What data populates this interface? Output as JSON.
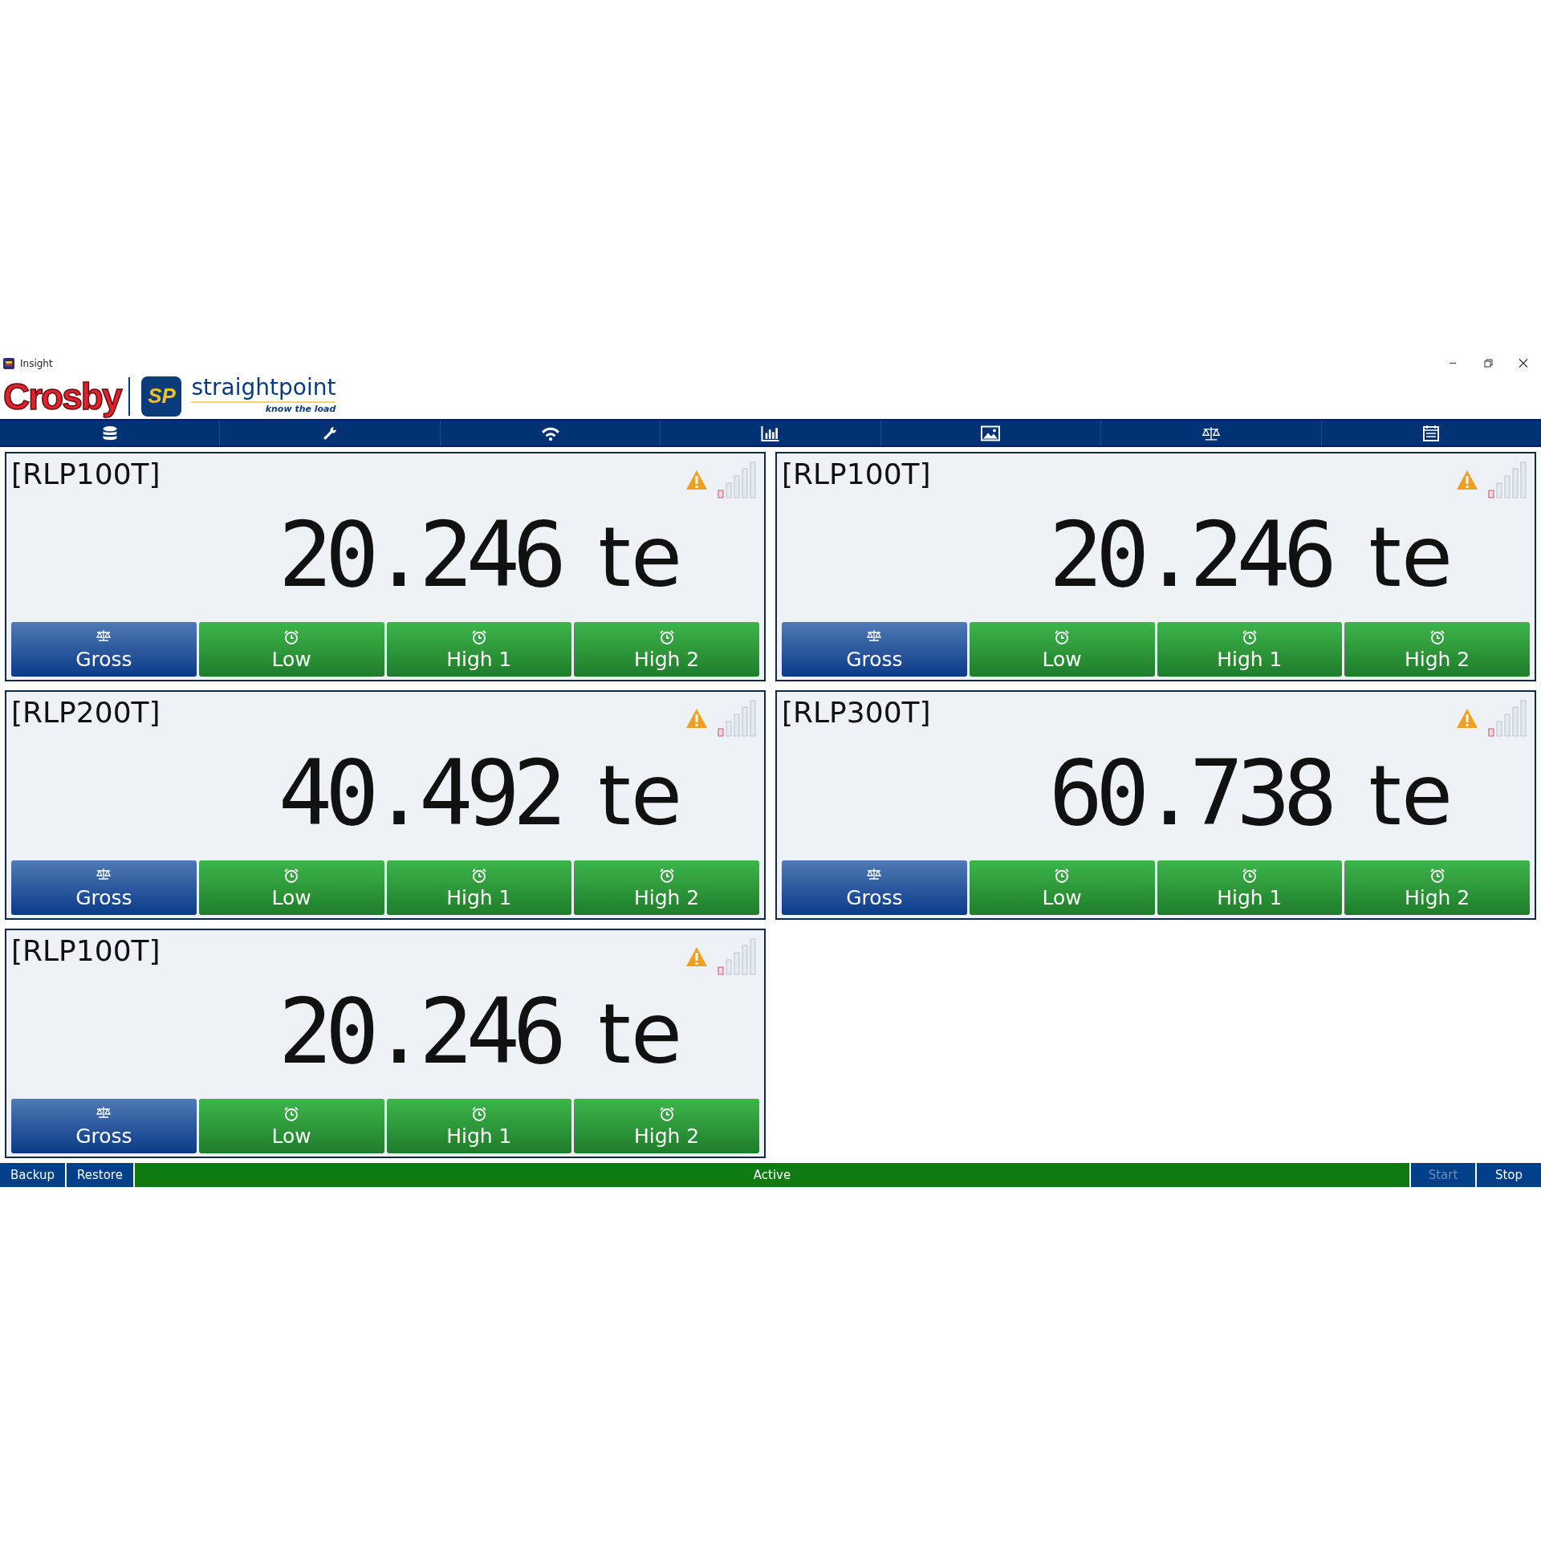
{
  "window": {
    "title": "Insight"
  },
  "brand": {
    "primary": "Crosby",
    "badge": "SP",
    "secondary": "straightpoint",
    "tagline": "know the load"
  },
  "nav_tabs": [
    {
      "kind": "database"
    },
    {
      "kind": "wrench"
    },
    {
      "kind": "wifi"
    },
    {
      "kind": "chart"
    },
    {
      "kind": "image"
    },
    {
      "kind": "scale"
    },
    {
      "kind": "calendar"
    }
  ],
  "cards": [
    {
      "name": "[RLP100T]",
      "value": "20.246",
      "unit": "te",
      "warning": true,
      "buttons": [
        {
          "label": "Gross",
          "kind": "gross"
        },
        {
          "label": "Low",
          "kind": "alarm"
        },
        {
          "label": "High 1",
          "kind": "alarm"
        },
        {
          "label": "High 2",
          "kind": "alarm"
        }
      ]
    },
    {
      "name": "[RLP100T]",
      "value": "20.246",
      "unit": "te",
      "warning": true,
      "buttons": [
        {
          "label": "Gross",
          "kind": "gross"
        },
        {
          "label": "Low",
          "kind": "alarm"
        },
        {
          "label": "High 1",
          "kind": "alarm"
        },
        {
          "label": "High 2",
          "kind": "alarm"
        }
      ]
    },
    {
      "name": "[RLP200T]",
      "value": "40.492",
      "unit": "te",
      "warning": true,
      "buttons": [
        {
          "label": "Gross",
          "kind": "gross"
        },
        {
          "label": "Low",
          "kind": "alarm"
        },
        {
          "label": "High 1",
          "kind": "alarm"
        },
        {
          "label": "High 2",
          "kind": "alarm"
        }
      ]
    },
    {
      "name": "[RLP300T]",
      "value": "60.738",
      "unit": "te",
      "warning": true,
      "buttons": [
        {
          "label": "Gross",
          "kind": "gross"
        },
        {
          "label": "Low",
          "kind": "alarm"
        },
        {
          "label": "High 1",
          "kind": "alarm"
        },
        {
          "label": "High 2",
          "kind": "alarm"
        }
      ]
    },
    {
      "name": "[RLP100T]",
      "value": "20.246",
      "unit": "te",
      "warning": true,
      "buttons": [
        {
          "label": "Gross",
          "kind": "gross"
        },
        {
          "label": "Low",
          "kind": "alarm"
        },
        {
          "label": "High 1",
          "kind": "alarm"
        },
        {
          "label": "High 2",
          "kind": "alarm"
        }
      ]
    }
  ],
  "status_bar": {
    "left_buttons": [
      {
        "label": "Backup",
        "disabled": false
      },
      {
        "label": "Restore",
        "disabled": false
      }
    ],
    "status": "Active",
    "right_buttons": [
      {
        "label": "Start",
        "disabled": true
      },
      {
        "label": "Stop",
        "disabled": false
      }
    ]
  }
}
